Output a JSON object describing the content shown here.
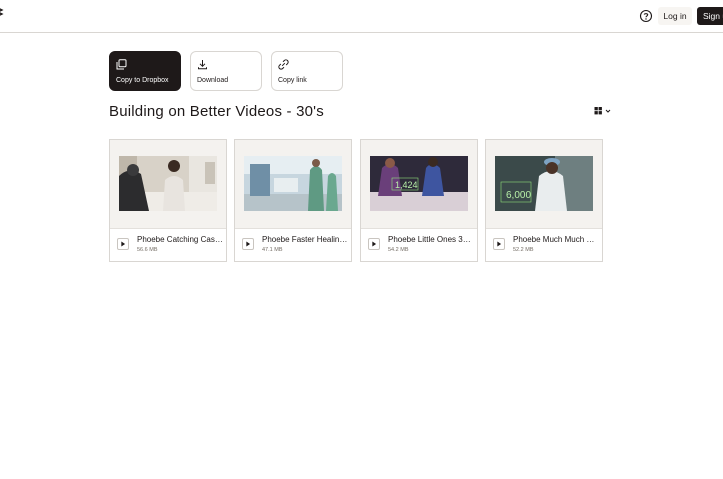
{
  "header": {
    "icons": {
      "logo": "logo-icon",
      "help": "help-icon"
    },
    "login_label": "Log in",
    "signup_label": "Sign u"
  },
  "actions": [
    {
      "label": "Copy to Dropbox",
      "icon": "copy-icon",
      "primary": true
    },
    {
      "label": "Download",
      "icon": "download-icon",
      "primary": false
    },
    {
      "label": "Copy link",
      "icon": "link-icon",
      "primary": false
    }
  ],
  "folder": {
    "title": "Building on Better Videos - 30's",
    "view_toggle_icon": "grid-view-icon"
  },
  "files": [
    {
      "name": "Phoebe Catching Cas…",
      "size": "56.6 MB",
      "thumb_caption": ""
    },
    {
      "name": "Phoebe Faster Healin…",
      "size": "47.1 MB",
      "thumb_caption": ""
    },
    {
      "name": "Phoebe Little Ones 3…",
      "size": "54.2 MB",
      "thumb_caption": "1,424"
    },
    {
      "name": "Phoebe Much Much …",
      "size": "52.2 MB",
      "thumb_caption": "6,000"
    }
  ],
  "colors": {
    "ink": "#1e1919",
    "border": "#d9d6d2",
    "thumb_bg": "#f4f2ef",
    "overlay": "#8fe07a"
  }
}
